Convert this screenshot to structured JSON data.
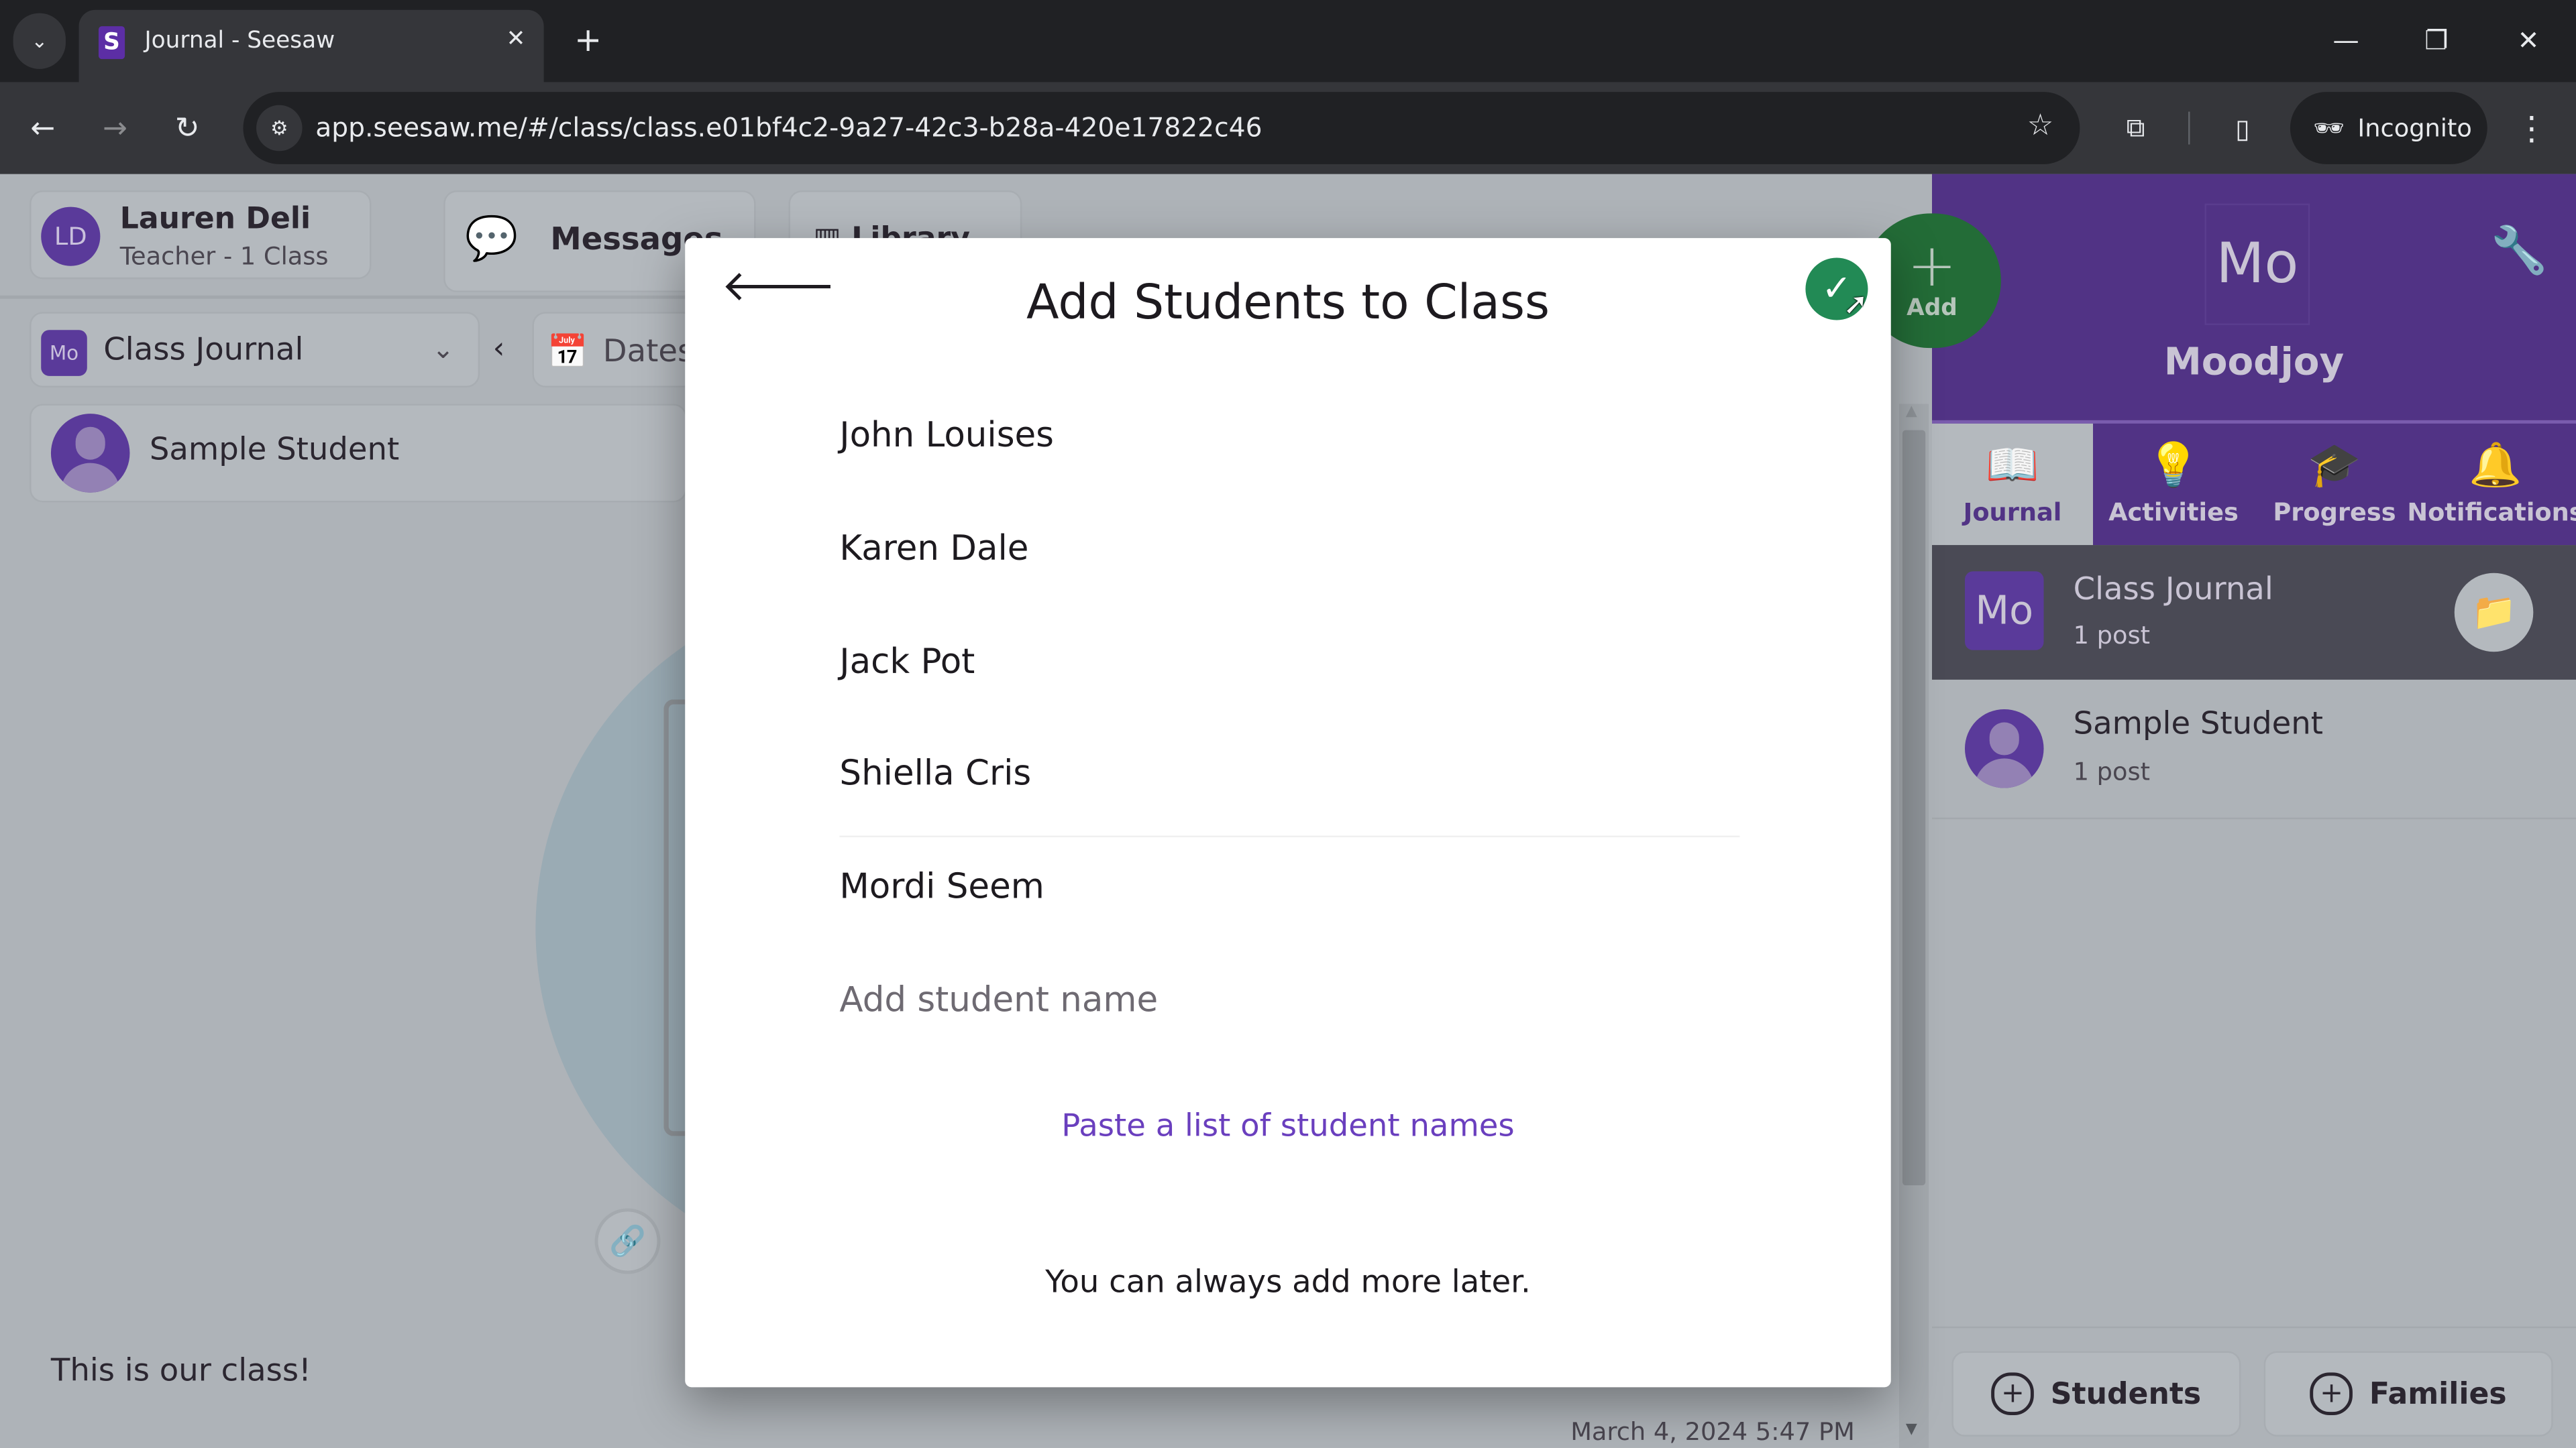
{
  "browser": {
    "tab_title": "Journal - Seesaw",
    "tab_favicon": "S",
    "url": "app.seesaw.me/#/class/class.e01bf4c2-9a27-42c3-b28a-420e17822c46",
    "incognito_label": "Incognito",
    "icons": {
      "tab_list": "⌄",
      "close_tab": "✕",
      "new_tab": "+",
      "minimize": "—",
      "restore": "❐",
      "close_window": "✕",
      "back": "←",
      "forward": "→",
      "reload": "↻",
      "site_info": "⚙",
      "bookmark_star": "☆",
      "extensions": "⧉",
      "side_panel": "▯",
      "incognito": "🕶",
      "menu": "⋮"
    }
  },
  "header": {
    "user_initials": "LD",
    "user_name": "Lauren Deli",
    "user_role": "Teacher - 1 Class",
    "messages_label": "Messages",
    "library_label": "Library"
  },
  "journal_toolbar": {
    "class_badge": "Mo",
    "class_select_value": "Class Journal",
    "dates_label": "Dates"
  },
  "feed": {
    "student_name": "Sample Student",
    "post_caption": "This is our class!",
    "post_timestamp": "March 4, 2024 5:47 PM"
  },
  "right_panel": {
    "class_initials": "Mo",
    "class_name": "Moodjoy",
    "add_button_label": "Add",
    "tabs": [
      {
        "label": "Journal",
        "icon": "📖",
        "active": true
      },
      {
        "label": "Activities",
        "icon": "💡",
        "active": false
      },
      {
        "label": "Progress",
        "icon": "🎓",
        "active": false
      },
      {
        "label": "Notifications",
        "icon": "🔔",
        "active": false
      }
    ],
    "list": [
      {
        "title": "Class Journal",
        "subtitle": "1 post",
        "badge": "Mo",
        "selected": true
      },
      {
        "title": "Sample Student",
        "subtitle": "1 post",
        "selected": false
      }
    ],
    "footer_buttons": [
      {
        "label": "Students"
      },
      {
        "label": "Families"
      }
    ]
  },
  "modal": {
    "title": "Add Students to Class",
    "students": [
      "John Louises",
      "Karen Dale",
      "Jack Pot",
      "Shiella Cris",
      "Mordi Seem"
    ],
    "add_name_value": "",
    "add_name_placeholder": "Add student name",
    "paste_link_label": "Paste a list of student names",
    "note": "You can always add more later."
  },
  "colors": {
    "brand_purple": "#513385",
    "confirm_green": "#228a55",
    "add_fab_green": "#236c37",
    "link_purple": "#6a3fbe"
  }
}
